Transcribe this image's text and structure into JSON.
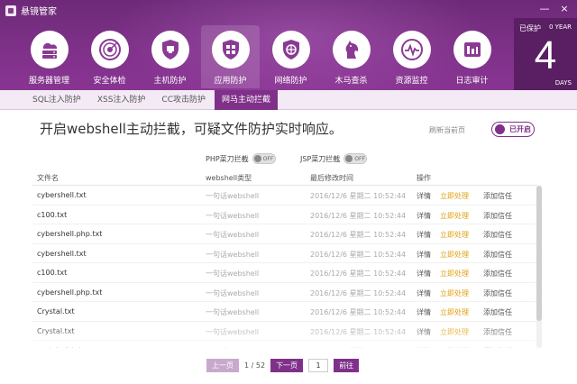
{
  "window": {
    "title": "悬镜管家",
    "controls": [
      "—",
      "×"
    ]
  },
  "nav": {
    "items": [
      {
        "label": "服务器管理",
        "icon": "server-cloud-icon"
      },
      {
        "label": "安全体检",
        "icon": "radar-icon"
      },
      {
        "label": "主机防护",
        "icon": "shield-icon"
      },
      {
        "label": "应用防护",
        "icon": "app-shield-icon",
        "active": true
      },
      {
        "label": "网络防护",
        "icon": "network-shield-icon"
      },
      {
        "label": "木马查杀",
        "icon": "horse-icon"
      },
      {
        "label": "资源监控",
        "icon": "monitor-pulse-icon"
      },
      {
        "label": "日志审计",
        "icon": "log-audit-icon"
      }
    ]
  },
  "protect": {
    "label": "已保护",
    "year": "0 YEAR",
    "days": "4",
    "unit": "DAYS"
  },
  "subtabs": [
    "SQL注入防护",
    "XSS注入防护",
    "CC攻击防护",
    "网马主动拦截"
  ],
  "active_subtab": 3,
  "content": {
    "heading": "开启webshell主动拦截，可疑文件防护实时响应。",
    "refresh": "刷新当前页",
    "toggle_label": "已开启",
    "php_switch": {
      "label": "PHP菜刀拦截",
      "state": "OFF"
    },
    "jsp_switch": {
      "label": "JSP菜刀拦截",
      "state": "OFF"
    }
  },
  "table": {
    "headers": [
      "文件名",
      "webshell类型",
      "最后修改时间",
      "操作"
    ],
    "rows": [
      [
        "cybershell.txt",
        "一句话webshell",
        "2016/12/6 星期二 10:52:44"
      ],
      [
        "c100.txt",
        "一句话webshell",
        "2016/12/6 星期二 10:52:44"
      ],
      [
        "cybershell.php.txt",
        "一句话webshell",
        "2016/12/6 星期二 10:52:44"
      ],
      [
        "cybershell.txt",
        "一句话webshell",
        "2016/12/6 星期二 10:52:44"
      ],
      [
        "c100.txt",
        "一句话webshell",
        "2016/12/6 星期二 10:52:44"
      ],
      [
        "cybershell.php.txt",
        "一句话webshell",
        "2016/12/6 星期二 10:52:44"
      ],
      [
        "Crystal.txt",
        "一句话webshell",
        "2016/12/6 星期二 10:52:44"
      ],
      [
        "Crystal.txt",
        "一句话webshell",
        "2016/12/6 星期二 10:52:44"
      ],
      [
        "cyetshell.txt",
        "一句话webshell",
        "2016/12/6 星期二 10:52:44"
      ]
    ],
    "actions": [
      "详情",
      "立即处理",
      "添加信任"
    ]
  },
  "pager": {
    "prev": "上一页",
    "count": "1 / 52",
    "next": "下一页",
    "input": "1",
    "go": "前往"
  },
  "colors": {
    "brand": "#7f3189",
    "header_dark": "#5a1f63",
    "action_highlight": "#e0a010"
  }
}
